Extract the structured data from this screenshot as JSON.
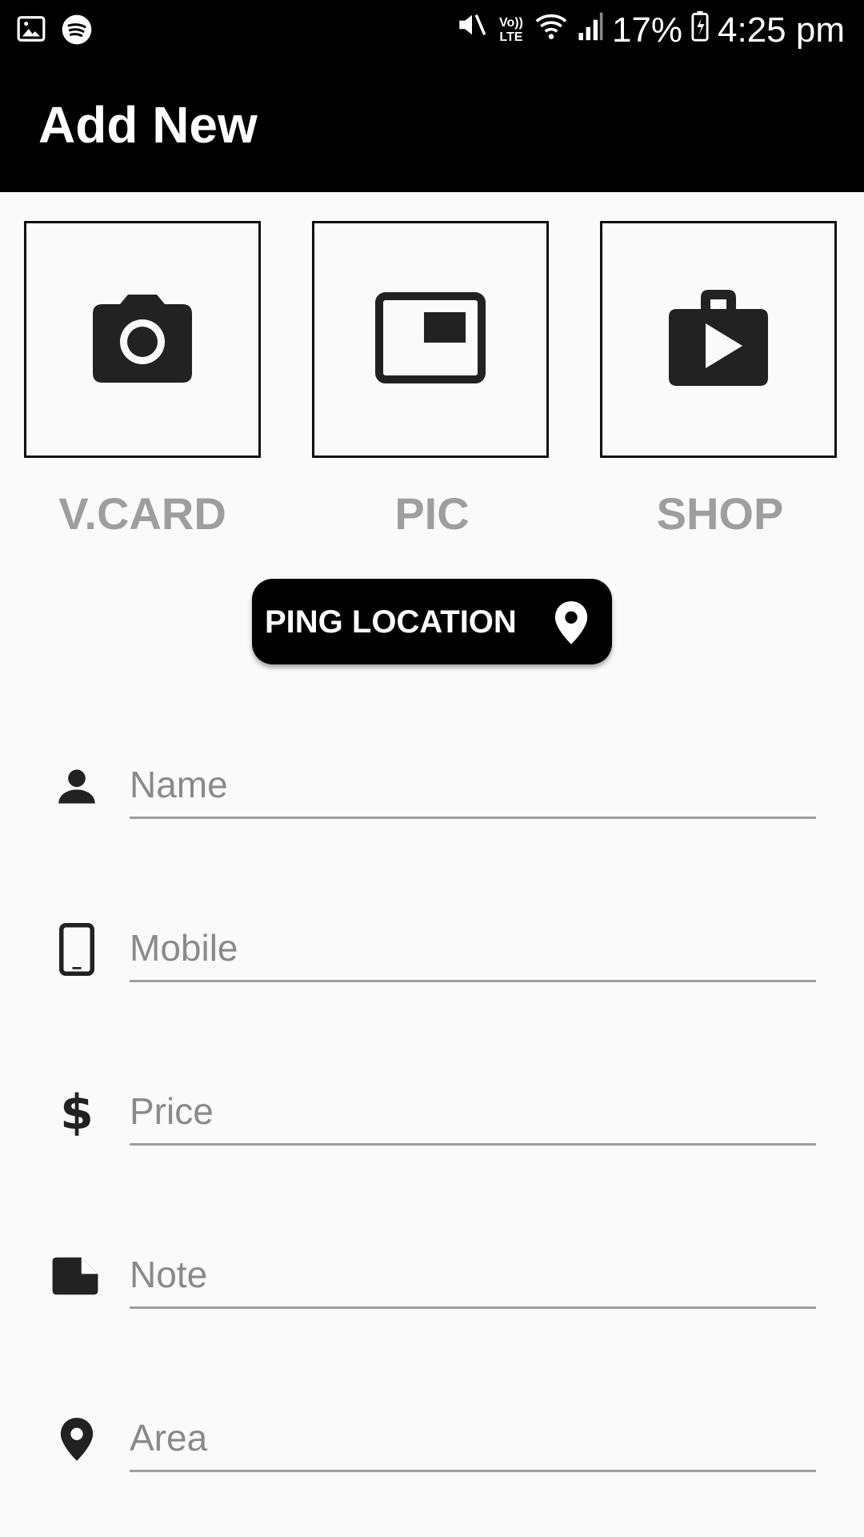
{
  "status_bar": {
    "battery": "17%",
    "time": "4:25 pm",
    "icons": [
      "gallery-icon",
      "spotify-icon",
      "mute-icon",
      "volte-icon",
      "wifi-icon",
      "signal-icon",
      "battery-icon"
    ],
    "volte_text": "Vo)) LTE"
  },
  "app_bar": {
    "title": "Add New"
  },
  "tiles": [
    {
      "label": "V.CARD",
      "icon": "camera-icon"
    },
    {
      "label": "PIC",
      "icon": "picture-in-picture-icon"
    },
    {
      "label": "SHOP",
      "icon": "shop-icon"
    }
  ],
  "ping_button": {
    "label": "PING LOCATION",
    "icon": "location-pin-icon"
  },
  "form": {
    "fields": [
      {
        "placeholder": "Name",
        "value": "",
        "icon": "person-icon"
      },
      {
        "placeholder": "Mobile",
        "value": "",
        "icon": "phone-icon"
      },
      {
        "placeholder": "Price",
        "value": "",
        "icon": "dollar-icon"
      },
      {
        "placeholder": "Note",
        "value": "",
        "icon": "note-icon"
      },
      {
        "placeholder": "Area",
        "value": "",
        "icon": "location-pin-icon"
      }
    ]
  },
  "colors": {
    "bar_background": "#000000",
    "page_background": "#fafafa",
    "tile_label": "#9e9e9e",
    "underline": "#9e9e9e",
    "icon": "#222222"
  }
}
